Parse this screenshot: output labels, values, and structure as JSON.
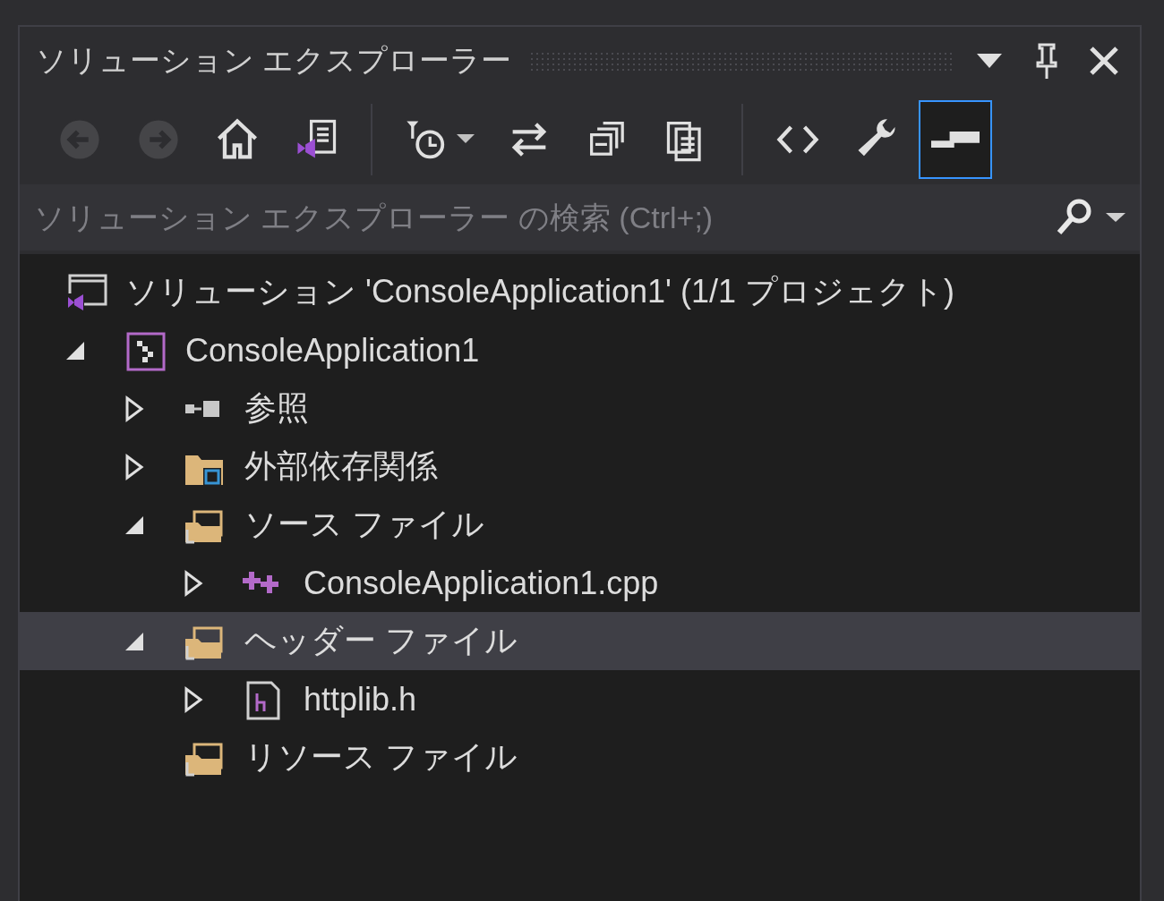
{
  "panel": {
    "title": "ソリューション エクスプローラー"
  },
  "toolbar": {
    "groups": [
      [
        {
          "kind": "back",
          "disabled": true,
          "selected": false
        },
        {
          "kind": "forward",
          "disabled": true,
          "selected": false
        },
        {
          "kind": "home",
          "disabled": false,
          "selected": false
        },
        {
          "kind": "switch-views",
          "disabled": false,
          "selected": false
        }
      ],
      [
        {
          "kind": "pending-changes",
          "disabled": false,
          "selected": false
        },
        {
          "kind": "sync",
          "disabled": false,
          "selected": false
        },
        {
          "kind": "collapse-all",
          "disabled": false,
          "selected": false
        },
        {
          "kind": "show-all-files",
          "disabled": false,
          "selected": false
        }
      ],
      [
        {
          "kind": "view-code",
          "disabled": false,
          "selected": false
        },
        {
          "kind": "properties",
          "disabled": false,
          "selected": false
        },
        {
          "kind": "preview",
          "disabled": false,
          "selected": true
        }
      ]
    ]
  },
  "search": {
    "placeholder": "ソリューション エクスプローラー の検索 (Ctrl+;)"
  },
  "tree": [
    {
      "kind": "solution",
      "label": "ソリューション 'ConsoleApplication1' (1/1 プロジェクト)",
      "selected": false,
      "children": [
        {
          "kind": "project",
          "label": "ConsoleApplication1",
          "expanded": true,
          "selected": false,
          "children": [
            {
              "kind": "references",
              "label": "参照",
              "expanded": false,
              "selected": false
            },
            {
              "kind": "external",
              "label": "外部依存関係",
              "expanded": false,
              "selected": false
            },
            {
              "kind": "folder",
              "label": "ソース ファイル",
              "expanded": true,
              "selected": false,
              "children": [
                {
                  "kind": "cpp",
                  "label": "ConsoleApplication1.cpp",
                  "expanded": false,
                  "selected": false
                }
              ]
            },
            {
              "kind": "folder",
              "label": "ヘッダー ファイル",
              "expanded": true,
              "selected": true,
              "children": [
                {
                  "kind": "header",
                  "label": "httplib.h",
                  "expanded": false,
                  "selected": false
                }
              ]
            },
            {
              "kind": "folder",
              "label": "リソース ファイル",
              "selected": false
            }
          ]
        }
      ]
    }
  ]
}
